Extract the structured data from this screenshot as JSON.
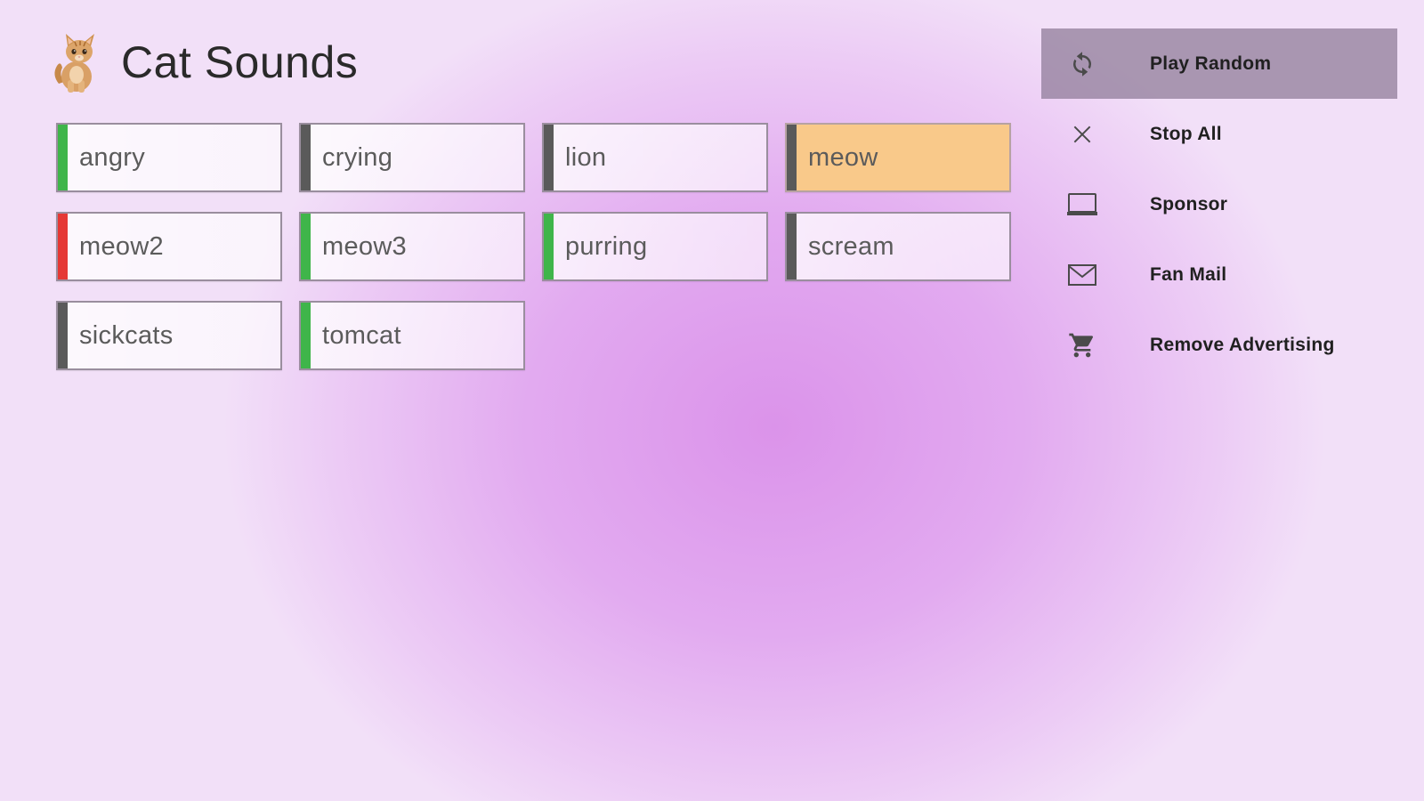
{
  "app": {
    "title": "Cat Sounds"
  },
  "sounds": [
    {
      "label": "angry",
      "stripe": "#3fb54a",
      "active": false
    },
    {
      "label": "crying",
      "stripe": "#5a5a5a",
      "active": false
    },
    {
      "label": "lion",
      "stripe": "#5a5a5a",
      "active": false
    },
    {
      "label": "meow",
      "stripe": "#5a5a5a",
      "active": true
    },
    {
      "label": "meow2",
      "stripe": "#e53935",
      "active": false
    },
    {
      "label": "meow3",
      "stripe": "#3fb54a",
      "active": false
    },
    {
      "label": "purring",
      "stripe": "#3fb54a",
      "active": false
    },
    {
      "label": "scream",
      "stripe": "#5a5a5a",
      "active": false
    },
    {
      "label": "sickcats",
      "stripe": "#5a5a5a",
      "active": false
    },
    {
      "label": "tomcat",
      "stripe": "#3fb54a",
      "active": false
    }
  ],
  "menu": [
    {
      "label": "Play Random",
      "icon": "refresh-icon",
      "highlighted": true
    },
    {
      "label": "Stop All",
      "icon": "close-icon",
      "highlighted": false
    },
    {
      "label": "Sponsor",
      "icon": "laptop-icon",
      "highlighted": false
    },
    {
      "label": "Fan Mail",
      "icon": "mail-icon",
      "highlighted": false
    },
    {
      "label": "Remove Advertising",
      "icon": "cart-icon",
      "highlighted": false
    }
  ],
  "colors": {
    "active_tile": "#f9c98a",
    "menu_highlight": "#8c7896"
  }
}
